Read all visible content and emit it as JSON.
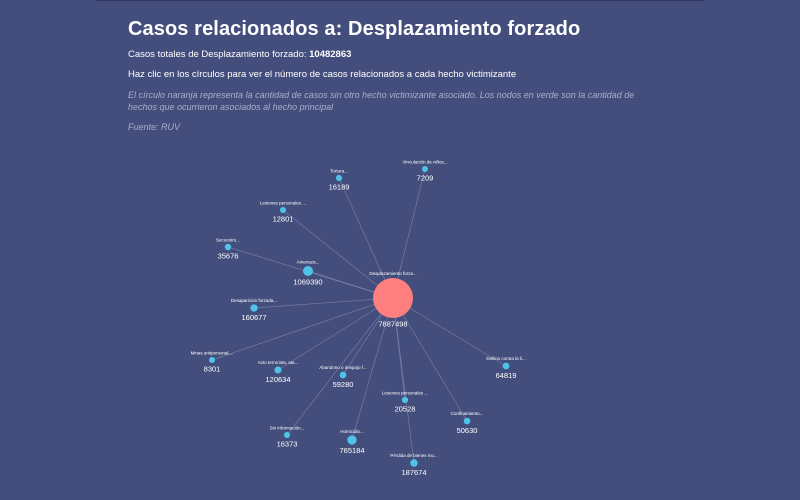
{
  "header": {
    "title": "Casos relacionados a: Desplazamiento forzado",
    "total_label": "Casos totales de Desplazamiento forzado: ",
    "total_value": "10482863",
    "instruction": "Haz clic en los círculos para ver el número de casos relacionados a cada hecho victimizante",
    "note": "El círculo naranja representa la cantidad de casos sin otro hecho victimizante asociado. Los nodos en verde son la cantidad de hechos que ocurrieron asociados al hecho principal",
    "source": "Fuente: RUV"
  },
  "colors": {
    "background": "#444e7d",
    "center_node": "#ff7f7f",
    "leaf_node": "#4fc3e8",
    "edge": "#7f87ad"
  },
  "graph": {
    "center": {
      "id": "center",
      "label": "Desplazamiento forza...",
      "value": "7887498",
      "count": 7887498
    },
    "nodes": [
      {
        "id": "tortura",
        "label": "Tortura...",
        "value": "16189",
        "count": 16189
      },
      {
        "id": "vinculacion",
        "label": "Vinculación de niños...",
        "value": "7209",
        "count": 7209
      },
      {
        "id": "lesiones1",
        "label": "Lesiones personales ...",
        "value": "12801",
        "count": 12801
      },
      {
        "id": "secuestro",
        "label": "Secuestro...",
        "value": "35676",
        "count": 35676
      },
      {
        "id": "amenaza",
        "label": "Amenaza...",
        "value": "1069390",
        "count": 1069390
      },
      {
        "id": "desaparicion",
        "label": "Desaparición forzada...",
        "value": "160677",
        "count": 160677
      },
      {
        "id": "minas",
        "label": "Minas antipersonal,...",
        "value": "8301",
        "count": 8301
      },
      {
        "id": "acto",
        "label": "Acto terrorista, ata...",
        "value": "120634",
        "count": 120634
      },
      {
        "id": "abandono",
        "label": "Abandono o despojo f...",
        "value": "59280",
        "count": 59280
      },
      {
        "id": "delitos",
        "label": "Delitos contra la li...",
        "value": "64819",
        "count": 64819
      },
      {
        "id": "lesiones2",
        "label": "Lesiones personales ...",
        "value": "20528",
        "count": 20528
      },
      {
        "id": "confinamiento",
        "label": "Confinamiento...",
        "value": "50630",
        "count": 50630
      },
      {
        "id": "sininfo",
        "label": "Sin información...",
        "value": "16373",
        "count": 16373
      },
      {
        "id": "homicidio",
        "label": "Homicidio...",
        "value": "765184",
        "count": 765184
      },
      {
        "id": "perdida",
        "label": "Pérdida de bienes mu...",
        "value": "187674",
        "count": 187674
      }
    ]
  }
}
